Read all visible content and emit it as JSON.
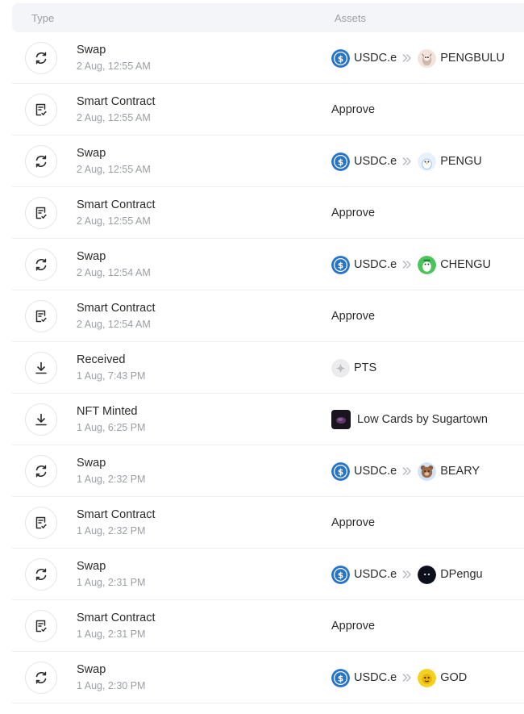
{
  "header": {
    "type_label": "Type",
    "assets_label": "Assets"
  },
  "rows": [
    {
      "kind": "swap",
      "title": "Swap",
      "time": "2 Aug, 12:55 AM",
      "from": "USDC.e",
      "to": "PENGBULU",
      "to_icon": "pengbulu-token-icon"
    },
    {
      "kind": "contract",
      "title": "Smart Contract",
      "time": "2 Aug, 12:55 AM",
      "asset": "Approve"
    },
    {
      "kind": "swap",
      "title": "Swap",
      "time": "2 Aug, 12:55 AM",
      "from": "USDC.e",
      "to": "PENGU",
      "to_icon": "pengu-token-icon"
    },
    {
      "kind": "contract",
      "title": "Smart Contract",
      "time": "2 Aug, 12:55 AM",
      "asset": "Approve"
    },
    {
      "kind": "swap",
      "title": "Swap",
      "time": "2 Aug, 12:54 AM",
      "from": "USDC.e",
      "to": "CHENGU",
      "to_icon": "chengu-token-icon"
    },
    {
      "kind": "contract",
      "title": "Smart Contract",
      "time": "2 Aug, 12:54 AM",
      "asset": "Approve"
    },
    {
      "kind": "received",
      "title": "Received",
      "time": "1 Aug, 7:43 PM",
      "asset": "PTS"
    },
    {
      "kind": "nft",
      "title": "NFT Minted",
      "time": "1 Aug, 6:25 PM",
      "asset": "Low Cards by Sugartown"
    },
    {
      "kind": "swap",
      "title": "Swap",
      "time": "1 Aug, 2:32 PM",
      "from": "USDC.e",
      "to": "BEARY",
      "to_icon": "beary-token-icon"
    },
    {
      "kind": "contract",
      "title": "Smart Contract",
      "time": "1 Aug, 2:32 PM",
      "asset": "Approve"
    },
    {
      "kind": "swap",
      "title": "Swap",
      "time": "1 Aug, 2:31 PM",
      "from": "USDC.e",
      "to": "DPengu",
      "to_icon": "dpengu-token-icon"
    },
    {
      "kind": "contract",
      "title": "Smart Contract",
      "time": "1 Aug, 2:31 PM",
      "asset": "Approve"
    },
    {
      "kind": "swap",
      "title": "Swap",
      "time": "1 Aug, 2:30 PM",
      "from": "USDC.e",
      "to": "GOD",
      "to_icon": "god-token-icon"
    }
  ],
  "colors": {
    "usdc_blue": "#2775ca",
    "header_bg": "#f4f5f8",
    "muted_text": "#9a9ea6"
  }
}
